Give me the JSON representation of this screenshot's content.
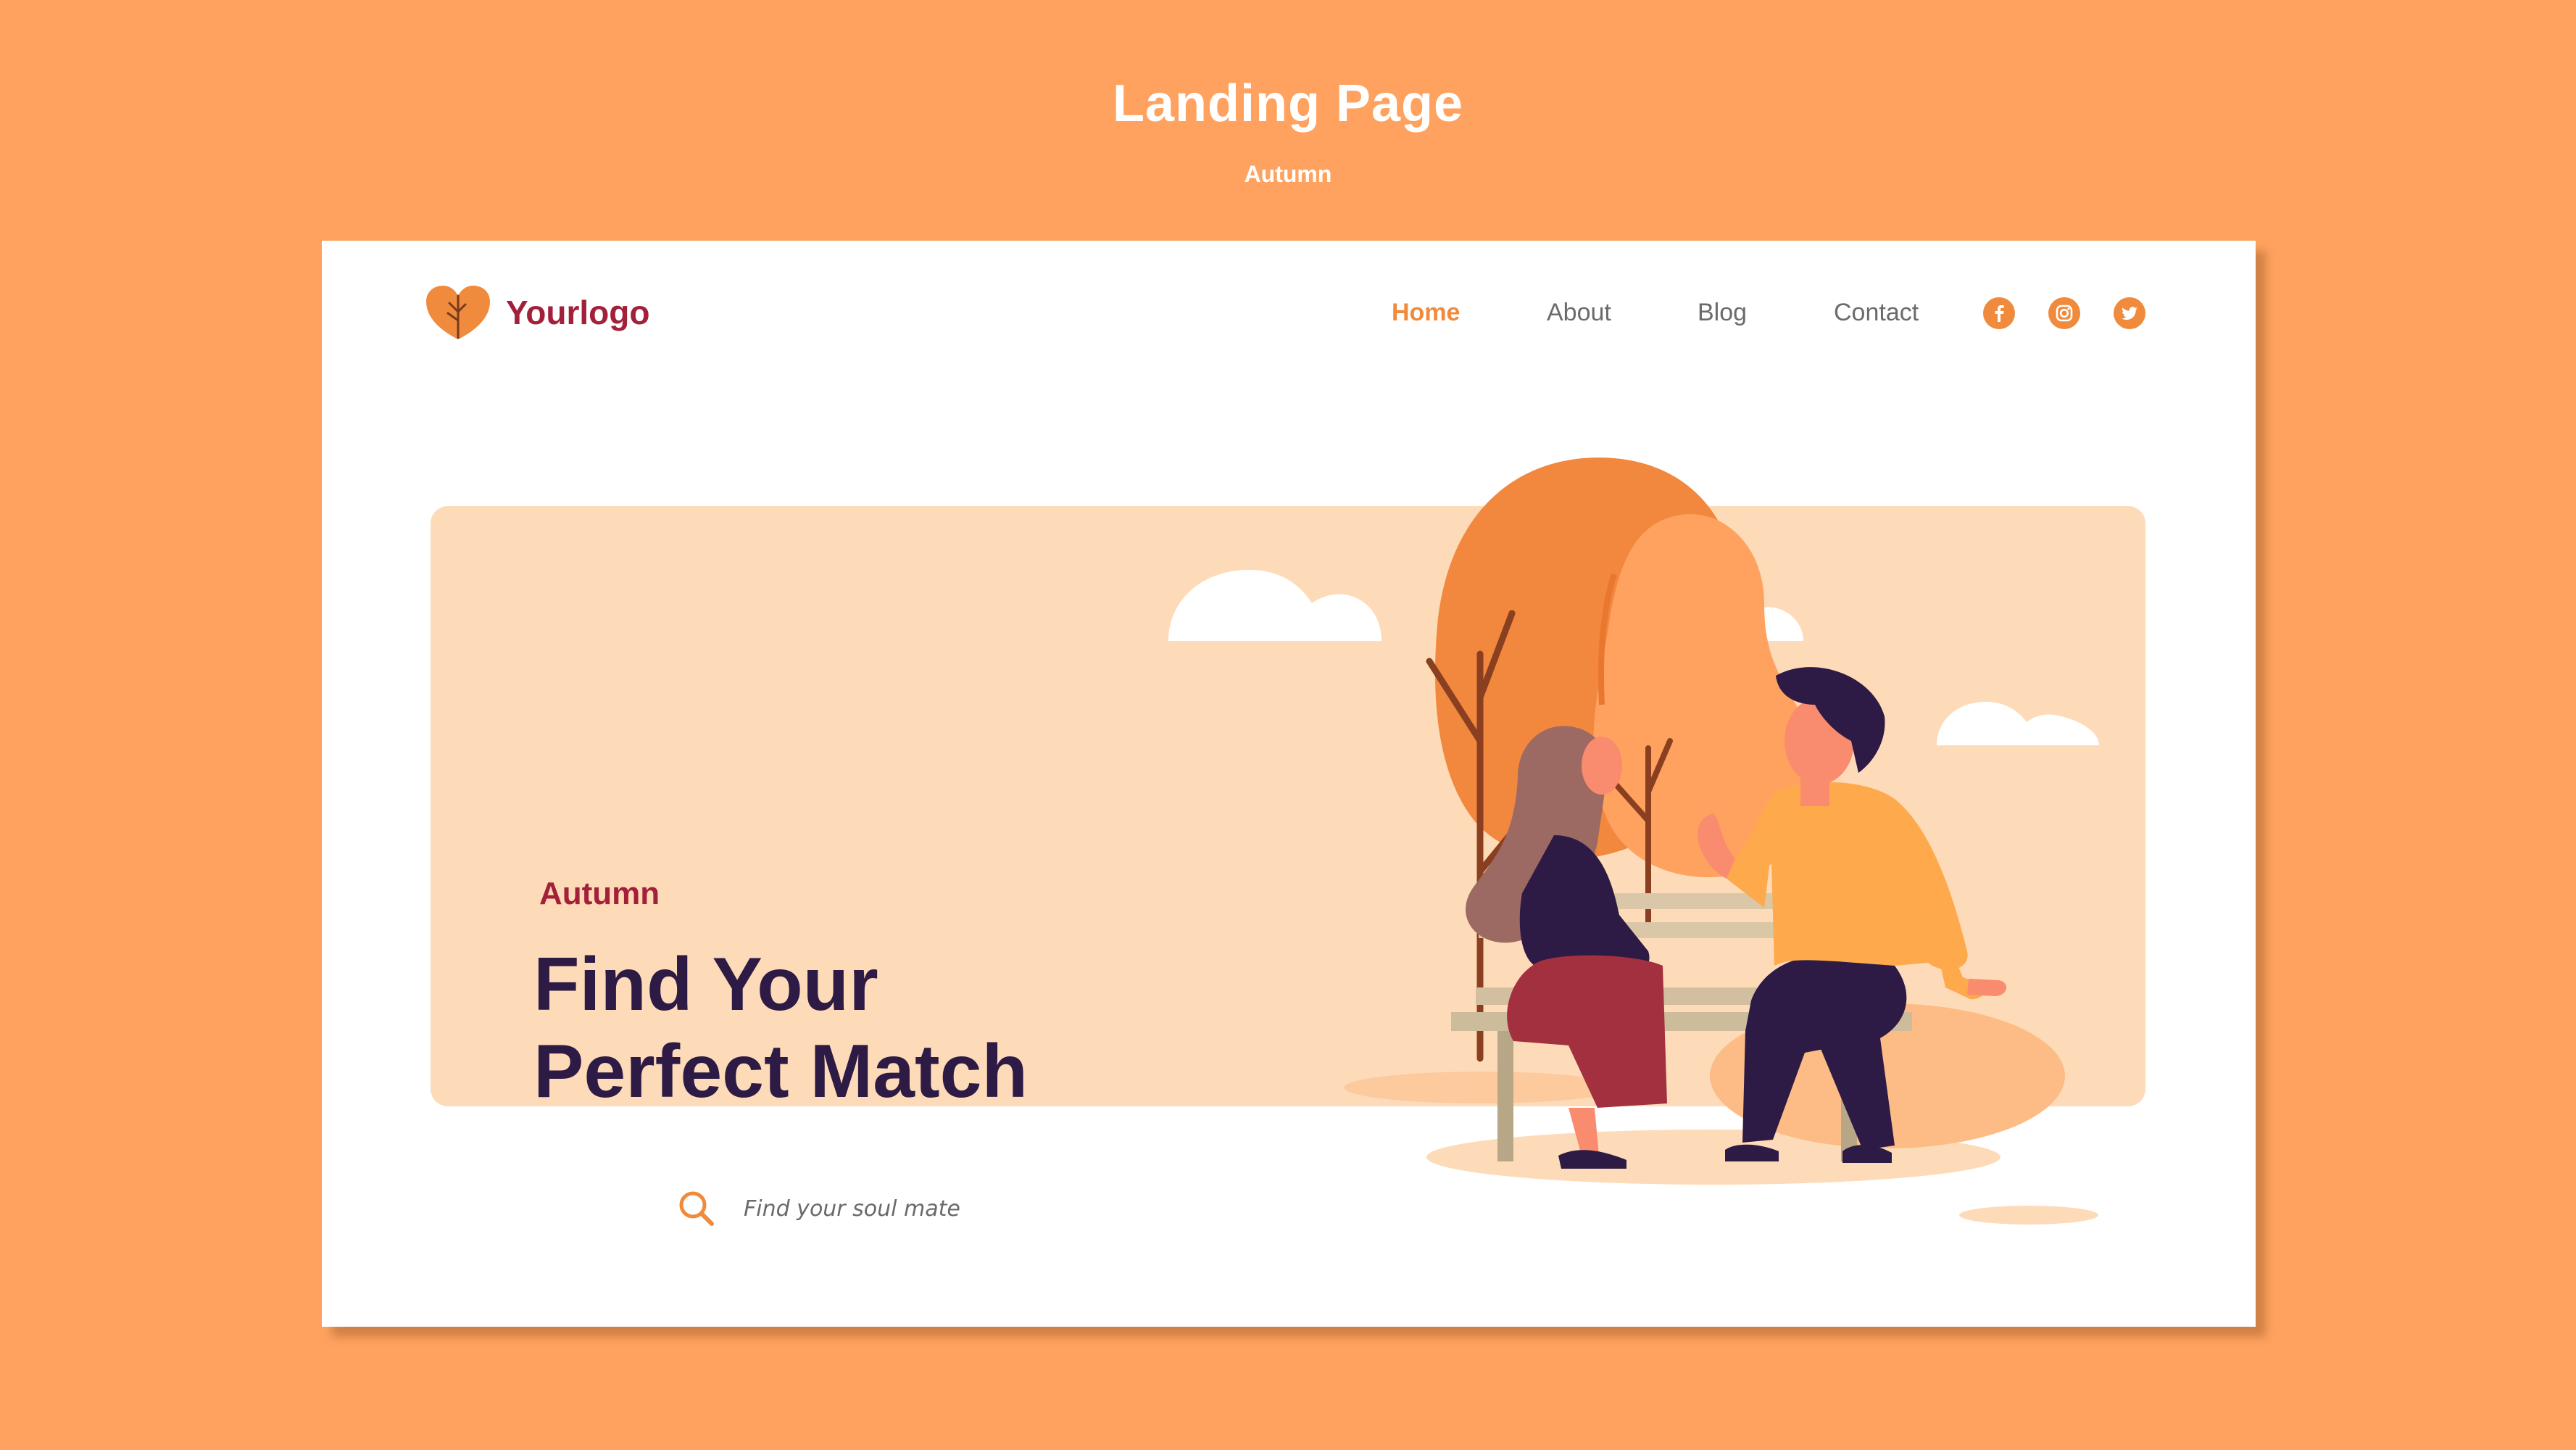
{
  "page": {
    "title": "Landing Page",
    "subtitle": "Autumn"
  },
  "navbar": {
    "logo_text": "Yourlogo",
    "links": [
      {
        "label": "Home",
        "active": true
      },
      {
        "label": "About",
        "active": false
      },
      {
        "label": "Blog",
        "active": false
      },
      {
        "label": "Contact",
        "active": false
      }
    ],
    "social_icons": [
      "facebook-icon",
      "instagram-icon",
      "twitter-icon"
    ]
  },
  "hero": {
    "eyebrow": "Autumn",
    "heading_line1": "Find Your",
    "heading_line2": "Perfect Match",
    "search_placeholder": "Find your soul mate",
    "search_value": ""
  },
  "colors": {
    "background": "#FFA25F",
    "accent": "#F08A3C",
    "logo_red": "#A3203A",
    "heading_dark": "#2D1A45",
    "hero_panel": "#FEDBB8",
    "card": "#FFFFFF"
  }
}
